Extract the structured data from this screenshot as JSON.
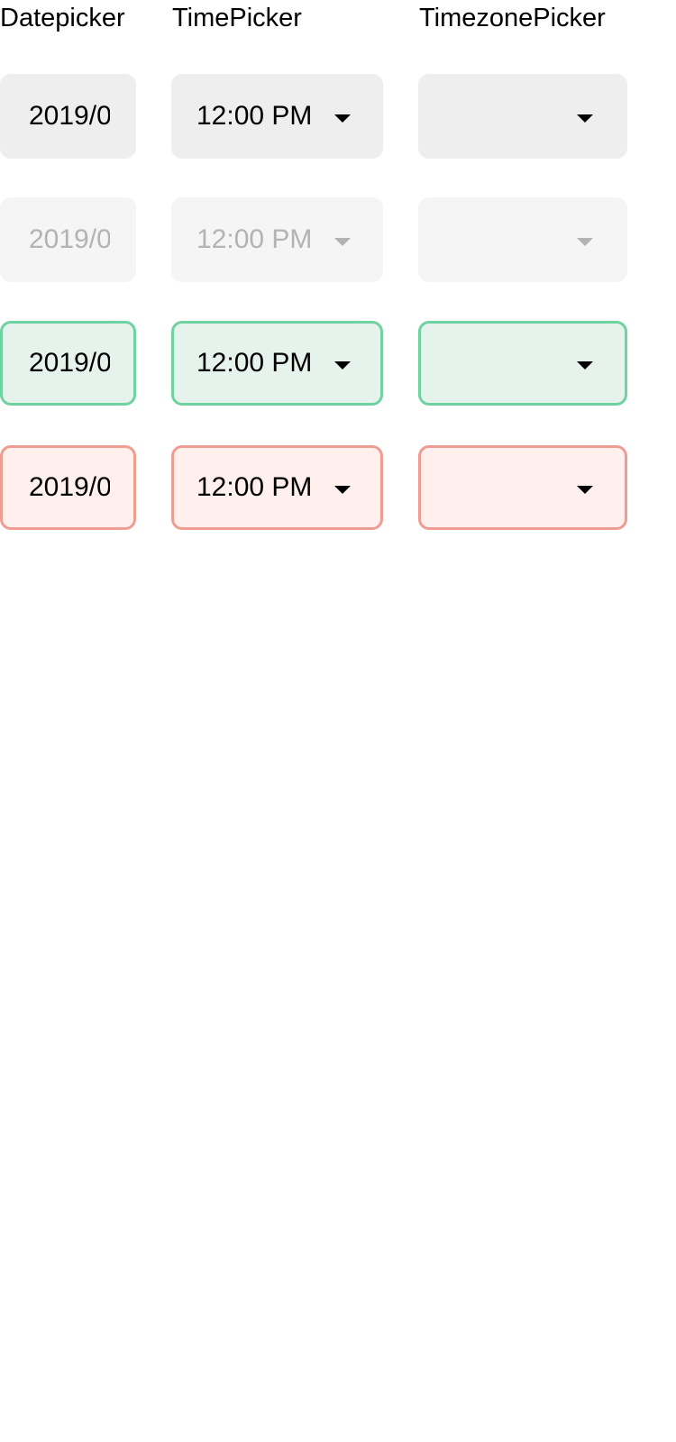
{
  "headers": {
    "datepicker": "Datepicker",
    "timepicker": "TimePicker",
    "timezonepicker": "TimezonePicker"
  },
  "rows": [
    {
      "state": "default",
      "date_value": "2019/0",
      "time_value": "12:00 PM",
      "timezone_value": ""
    },
    {
      "state": "disabled",
      "date_value": "2019/0",
      "time_value": "12:00 PM",
      "timezone_value": ""
    },
    {
      "state": "success",
      "date_value": "2019/0",
      "time_value": "12:00 PM",
      "timezone_value": ""
    },
    {
      "state": "error",
      "date_value": "2019/0",
      "time_value": "12:00 PM",
      "timezone_value": ""
    }
  ],
  "colors": {
    "default_bg": "#eeeeee",
    "disabled_bg": "#f5f5f5",
    "disabled_text": "#b3b3b3",
    "success_bg": "#e5f3ec",
    "success_border": "#6fd2a0",
    "error_bg": "#ffefed",
    "error_border": "#ef9d93"
  },
  "icons": {
    "dropdown": "caret-down-icon"
  }
}
